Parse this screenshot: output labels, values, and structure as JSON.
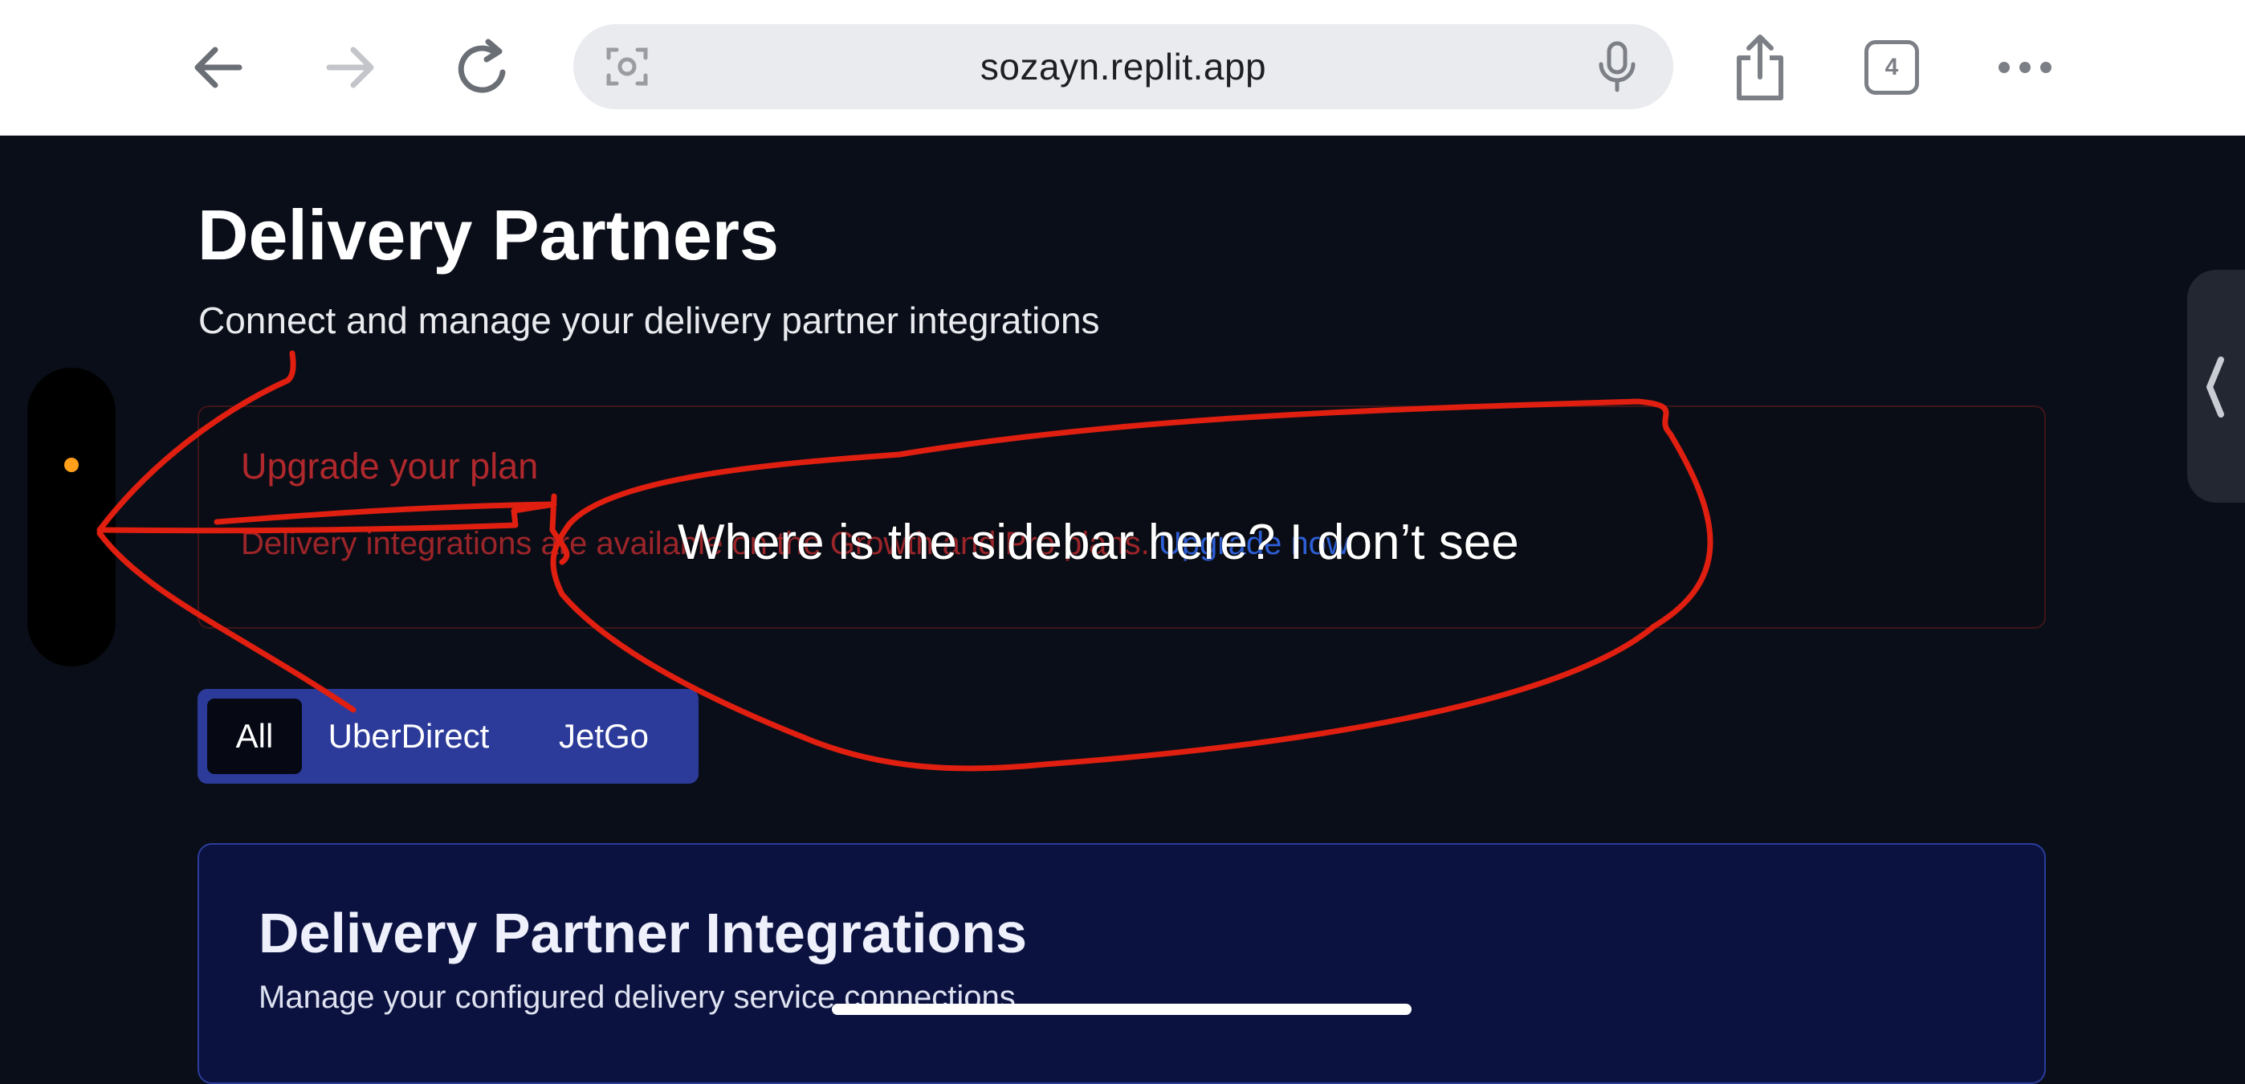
{
  "browser": {
    "url": "sozayn.replit.app",
    "tab_count": "4",
    "icons": [
      "back-arrow-icon",
      "forward-arrow-icon",
      "reload-icon",
      "screen-capture-icon",
      "microphone-icon",
      "share-icon",
      "tabs-icon",
      "more-icon"
    ]
  },
  "page": {
    "title": "Delivery Partners",
    "subtitle": "Connect and manage your delivery partner integrations"
  },
  "upgrade": {
    "title": "Upgrade your plan",
    "text": "Delivery integrations are available on the Growth and Pro plans.",
    "link": "Upgrade now"
  },
  "tabs": [
    {
      "label": "All"
    },
    {
      "label": "UberDirect"
    },
    {
      "label": "JetGo"
    }
  ],
  "card": {
    "title": "Delivery Partner Integrations",
    "subtitle": "Manage your configured delivery service connections"
  },
  "annotation": {
    "text": "Where is the sidebar here? I don’t see",
    "color": "#e01f10"
  },
  "colors": {
    "background": "#0a0e18",
    "tabs_bg": "#2c3b9a",
    "card_bg": "#0b1240",
    "alert_red": "#b0282c",
    "link_blue": "#2d5fd6",
    "indicator_orange": "#ff9f1a"
  }
}
